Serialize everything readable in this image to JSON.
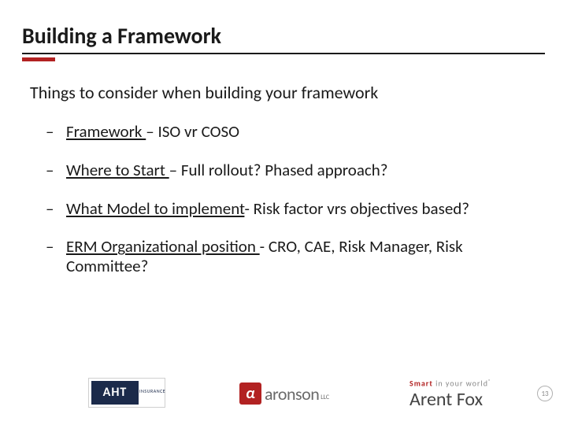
{
  "title": "Building a Framework",
  "subhead": "Things to consider when building your framework",
  "bullets": [
    {
      "label": "Framework ",
      "rest": "– ISO vr COSO"
    },
    {
      "label": "Where to Start ",
      "rest": "– Full rollout? Phased approach?"
    },
    {
      "label": "What Model to implement",
      "rest": "- Risk factor vrs objectives based?"
    },
    {
      "label": "ERM Organizational position  ",
      "rest": "- CRO, CAE, Risk Manager, Risk Committee?"
    }
  ],
  "logos": {
    "aht": {
      "text": "AHT",
      "tag": "INSURANCE"
    },
    "aronson": {
      "alpha": "α",
      "word": "aronson",
      "llc": "LLC"
    },
    "arentfox": {
      "tag_smart": "Smart",
      "tag_rest": " in your world",
      "reg": "®",
      "name": "Arent Fox"
    }
  },
  "slide_number": "13"
}
